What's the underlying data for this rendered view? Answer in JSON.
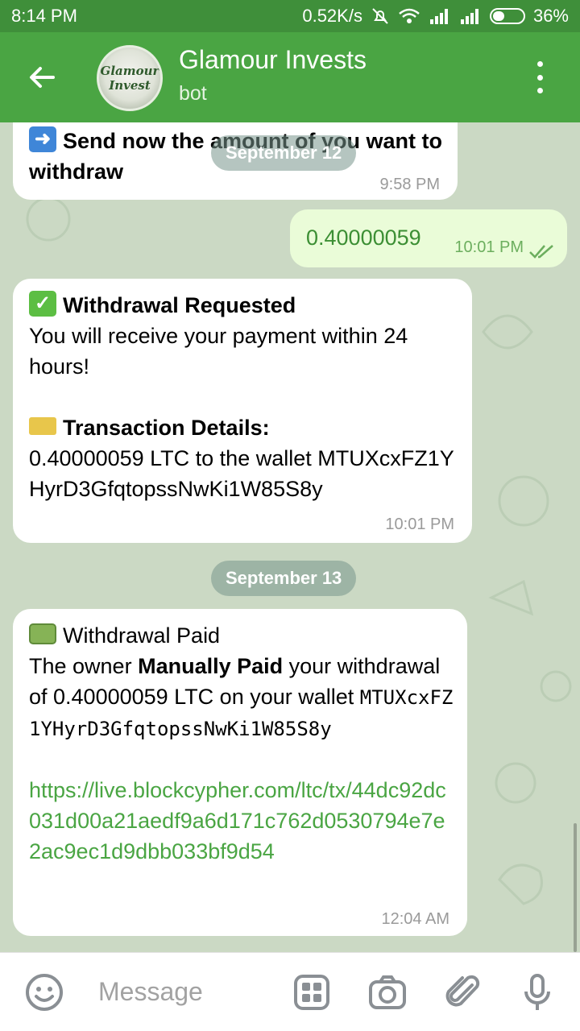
{
  "status": {
    "time": "8:14 PM",
    "speed": "0.52K/s",
    "battery": "36%"
  },
  "header": {
    "title": "Glamour Invests",
    "subtitle": "bot",
    "avatar_line1": "Glamour",
    "avatar_line2": "Invest"
  },
  "messages": {
    "m1": {
      "text_bold": "Send now the amount of  you want to withdraw",
      "time": "9:58 PM"
    },
    "date1": "September 12",
    "m2": {
      "text": "0.40000059",
      "time": "10:01 PM"
    },
    "m3": {
      "heading": "Withdrawal Requested",
      "line1": "You will receive your payment within 24 hours!",
      "details_heading": "Transaction Details:",
      "details": "0.40000059 LTC to the wallet MTUXcxFZ1YHyrD3GfqtopssNwKi1W85S8y",
      "time": "10:01 PM"
    },
    "date2": "September 13",
    "m4": {
      "heading": "Withdrawal Paid",
      "text_before": "The owner ",
      "text_bold": "Manually Paid",
      "text_after": " your withdrawal of 0.40000059 LTC on your wallet ",
      "wallet": "MTUXcxFZ1YHyrD3GfqtopssNwKi1W85S8y",
      "link": "https://live.blockcypher.com/ltc/tx/44dc92dc031d00a21aedf9a6d171c762d0530794e7e2ac9ec1d9dbb033bf9d54",
      "time": "12:04 AM"
    }
  },
  "input": {
    "placeholder": "Message"
  },
  "colors": {
    "header": "#4aa543",
    "statusbar": "#3f8f3a",
    "link": "#4aa543",
    "outgoing_bubble": "#eafcd8"
  },
  "icons": [
    "back-arrow-icon",
    "menu-dots-icon",
    "emoji-icon",
    "sticker-grid-icon",
    "camera-icon",
    "attach-icon",
    "mic-icon",
    "double-check-icon"
  ]
}
